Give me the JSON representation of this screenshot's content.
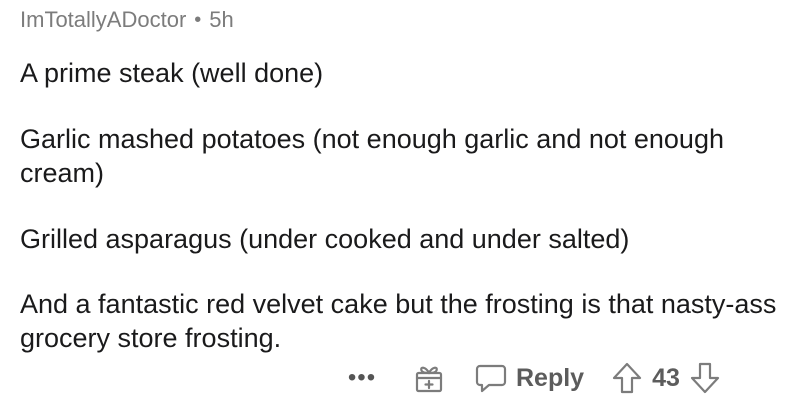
{
  "comment": {
    "author": "ImTotallyADoctor",
    "separator": "•",
    "age": "5h",
    "paragraphs": [
      "A prime steak (well done)",
      "Garlic mashed potatoes (not enough garlic and not enough cream)",
      "Grilled asparagus (under cooked and under salted)",
      "And a fantastic red velvet cake but the frosting is that nasty-ass grocery store frosting."
    ]
  },
  "actions": {
    "more_label": "•••",
    "reply_label": "Reply",
    "score": "43",
    "icons": [
      "more-icon",
      "gift-icon",
      "reply-icon",
      "upvote-icon",
      "downvote-icon"
    ]
  }
}
